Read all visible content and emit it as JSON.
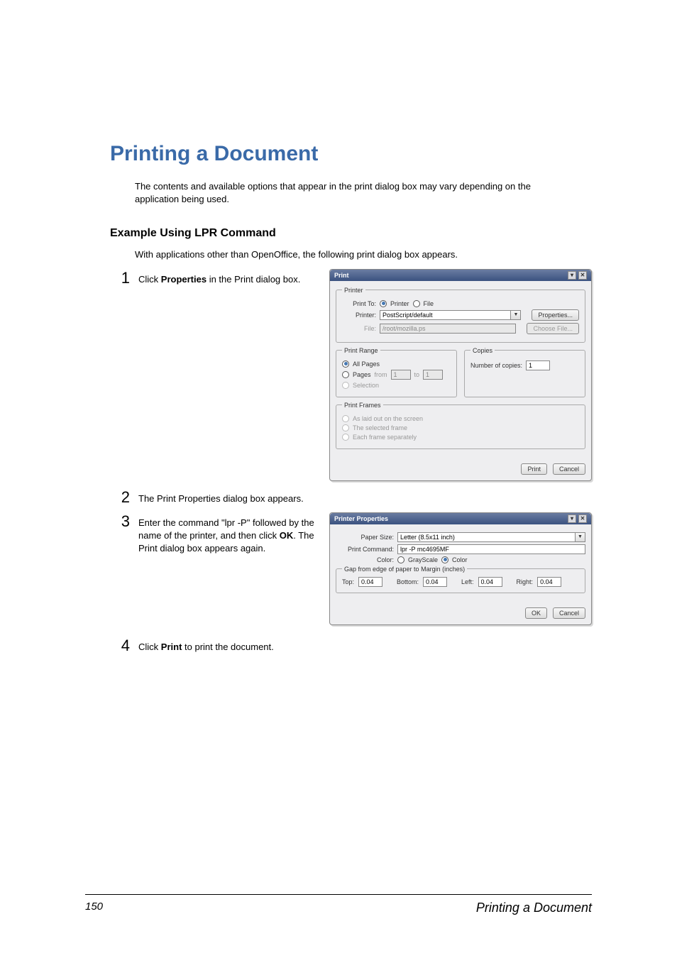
{
  "headings": {
    "h1": "Printing a Document",
    "intro": "The contents and available options that appear in the print dialog box may vary depending on the application being used.",
    "h2": "Example Using LPR Command",
    "subintro": "With applications other than OpenOffice, the following print dialog box appears."
  },
  "steps": {
    "s1a": "Click ",
    "s1b": "Properties",
    "s1c": " in the Print dialog box.",
    "s2": "The Print Properties dialog box appears.",
    "s3a": "Enter the command \"lpr -P\" followed by the name of the printer, and then click ",
    "s3b": "OK",
    "s3c": ". The Print dialog box appears again.",
    "s4a": "Click ",
    "s4b": "Print",
    "s4c": " to print the document."
  },
  "dlg1": {
    "title": "Print",
    "grp_printer": "Printer",
    "print_to": "Print To:",
    "opt_printer": "Printer",
    "opt_file": "File",
    "printer_lbl": "Printer:",
    "printer_val": "PostScript/default",
    "prop_btn": "Properties...",
    "file_lbl": "File:",
    "file_val": "/root/mozilla.ps",
    "choose_btn": "Choose File...",
    "grp_range": "Print Range",
    "all_pages": "All Pages",
    "pages": "Pages",
    "from": "from",
    "from_v": "1",
    "to": "to",
    "to_v": "1",
    "selection": "Selection",
    "grp_copies": "Copies",
    "copies_lbl": "Number of copies:",
    "copies_v": "1",
    "grp_frames": "Print Frames",
    "fr1": "As laid out on the screen",
    "fr2": "The selected frame",
    "fr3": "Each frame separately",
    "print_btn": "Print",
    "cancel_btn": "Cancel"
  },
  "dlg2": {
    "title": "Printer Properties",
    "paper_size": "Paper Size:",
    "paper_v": "Letter (8.5x11 inch)",
    "cmd_lbl": "Print Command:",
    "cmd_v": "lpr -P mc4695MF",
    "color_lbl": "Color:",
    "gray": "GrayScale",
    "color": "Color",
    "gap_lbl": "Gap from edge of paper to Margin (inches)",
    "top": "Top:",
    "bottom": "Bottom:",
    "left": "Left:",
    "right": "Right:",
    "v": "0.04",
    "ok": "OK",
    "cancel": "Cancel"
  },
  "footer": {
    "page": "150",
    "title": "Printing a Document"
  }
}
